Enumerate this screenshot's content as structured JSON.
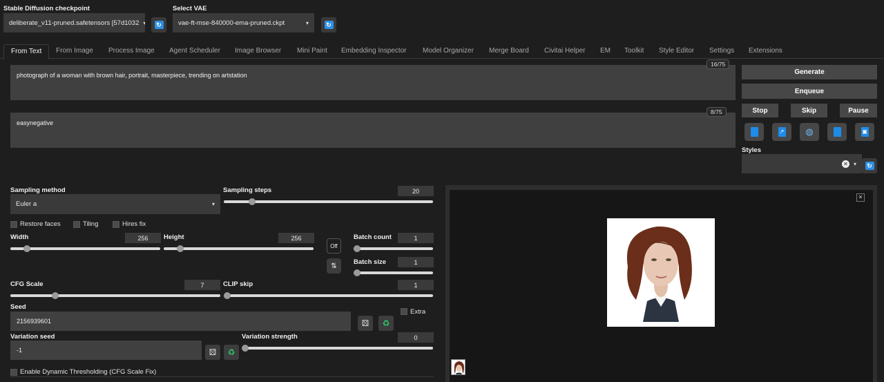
{
  "header": {
    "checkpoint_label": "Stable Diffusion checkpoint",
    "checkpoint_value": "deliberate_v11-pruned.safetensors [57d1032",
    "vae_label": "Select VAE",
    "vae_value": "vae-ft-mse-840000-ema-pruned.ckpt",
    "refresh_icon": "refresh-icon"
  },
  "tabs": [
    {
      "label": "From Text",
      "active": true
    },
    {
      "label": "From Image"
    },
    {
      "label": "Process Image"
    },
    {
      "label": "Agent Scheduler"
    },
    {
      "label": "Image Browser"
    },
    {
      "label": "Mini Paint"
    },
    {
      "label": "Embedding Inspector"
    },
    {
      "label": "Model Organizer"
    },
    {
      "label": "Merge Board"
    },
    {
      "label": "Civitai Helper"
    },
    {
      "label": "EM"
    },
    {
      "label": "Toolkit"
    },
    {
      "label": "Style Editor"
    },
    {
      "label": "Settings"
    },
    {
      "label": "Extensions"
    }
  ],
  "prompt": {
    "positive": "photograph of a woman with brown hair, portrait, masterpiece, trending on artstation",
    "positive_counter": "16/75",
    "negative": "easynegative",
    "negative_counter": "8/75"
  },
  "actions": {
    "generate": "Generate",
    "enqueue": "Enqueue",
    "stop": "Stop",
    "skip": "Skip",
    "pause": "Pause",
    "tool_icons": [
      "paste-icon",
      "paint-icon",
      "globe-icon",
      "notebook-icon",
      "save-style-icon"
    ],
    "styles_label": "Styles",
    "clear_icon": "✕"
  },
  "settings": {
    "sampling_method_label": "Sampling method",
    "sampling_method_value": "Euler a",
    "sampling_steps_label": "Sampling steps",
    "sampling_steps_value": "20",
    "sampling_steps_fraction": 0.19,
    "restore_faces": "Restore faces",
    "tiling": "Tiling",
    "hires_fix": "Hires fix",
    "width_label": "Width",
    "width_value": "256",
    "height_label": "Height",
    "height_value": "256",
    "off_label": "Off",
    "swap_icon": "⇅",
    "batch_count_label": "Batch count",
    "batch_count_value": "1",
    "batch_size_label": "Batch size",
    "batch_size_value": "1",
    "cfg_label": "CFG Scale",
    "cfg_value": "7",
    "clip_skip_label": "CLIP skip",
    "clip_skip_value": "1",
    "seed_label": "Seed",
    "seed_value": "2156939601",
    "extra_label": "Extra",
    "variation_seed_label": "Variation seed",
    "variation_seed_value": "-1",
    "variation_strength_label": "Variation strength",
    "variation_strength_value": "0",
    "dynamic_thresholding_label": "Enable Dynamic Thresholding (CFG Scale Fix)"
  },
  "gallery": {
    "close_icon": "✕",
    "image_desc": "portrait-image",
    "colors": {
      "hair": "#6b2e1a",
      "skin": "#e8c8b4",
      "coat": "#2b3440"
    }
  }
}
